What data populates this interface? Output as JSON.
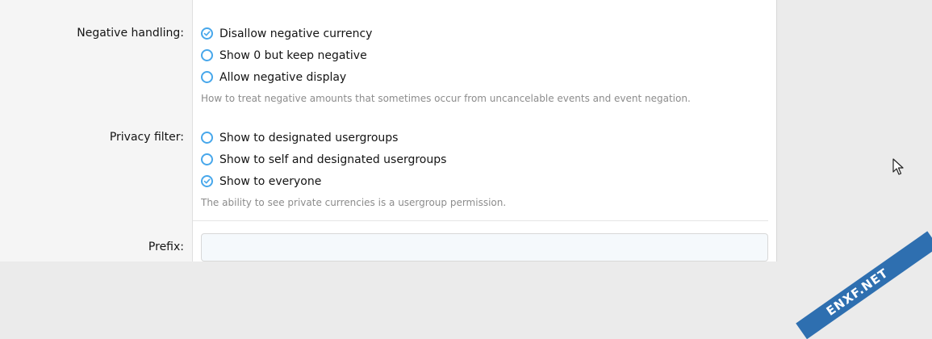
{
  "negative_handling": {
    "label": "Negative handling:",
    "options": [
      {
        "label": "Disallow negative currency",
        "checked": true
      },
      {
        "label": "Show 0 but keep negative",
        "checked": false
      },
      {
        "label": "Allow negative display",
        "checked": false
      }
    ],
    "hint": "How to treat negative amounts that sometimes occur from uncancelable events and event negation."
  },
  "privacy_filter": {
    "label": "Privacy filter:",
    "options": [
      {
        "label": "Show to designated usergroups",
        "checked": false
      },
      {
        "label": "Show to self and designated usergroups",
        "checked": false
      },
      {
        "label": "Show to everyone",
        "checked": true
      }
    ],
    "hint": "The ability to see private currencies is a usergroup permission."
  },
  "prefix": {
    "label": "Prefix:",
    "value": ""
  },
  "watermark": {
    "text": "ENXF.NET"
  },
  "colors": {
    "accent": "#47a7eb",
    "hint": "#8c8c8c",
    "panel_bg": "#ffffff",
    "page_bg": "#ebebeb"
  }
}
